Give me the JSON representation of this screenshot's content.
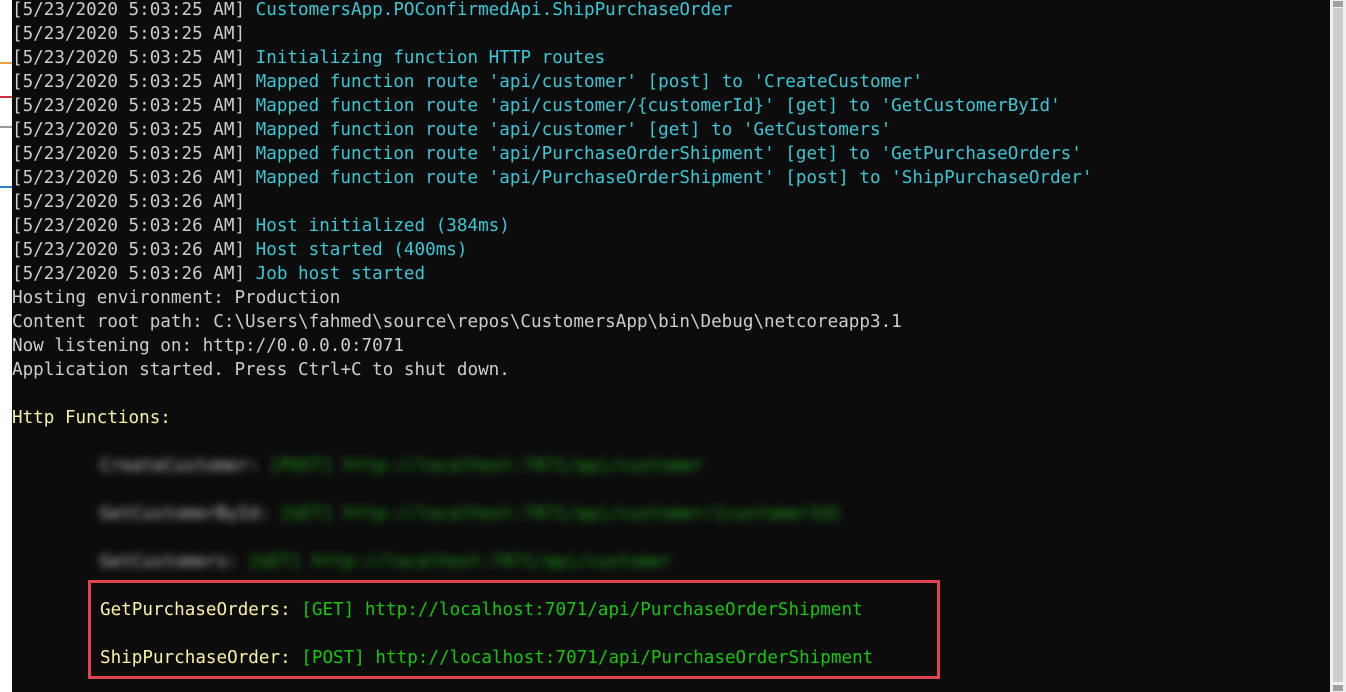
{
  "log_lines": [
    {
      "ts": "[5/23/2020 5:03:25 AM]",
      "msg": " CustomersApp.POConfirmedApi.ShipPurchaseOrder"
    },
    {
      "ts": "[5/23/2020 5:03:25 AM]",
      "msg": ""
    },
    {
      "ts": "[5/23/2020 5:03:25 AM]",
      "msg": " Initializing function HTTP routes"
    },
    {
      "ts": "[5/23/2020 5:03:25 AM]",
      "msg": " Mapped function route 'api/customer' [post] to 'CreateCustomer'"
    },
    {
      "ts": "[5/23/2020 5:03:25 AM]",
      "msg": " Mapped function route 'api/customer/{customerId}' [get] to 'GetCustomerById'"
    },
    {
      "ts": "[5/23/2020 5:03:25 AM]",
      "msg": " Mapped function route 'api/customer' [get] to 'GetCustomers'"
    },
    {
      "ts": "[5/23/2020 5:03:25 AM]",
      "msg": " Mapped function route 'api/PurchaseOrderShipment' [get] to 'GetPurchaseOrders'"
    },
    {
      "ts": "[5/23/2020 5:03:26 AM]",
      "msg": " Mapped function route 'api/PurchaseOrderShipment' [post] to 'ShipPurchaseOrder'"
    },
    {
      "ts": "[5/23/2020 5:03:26 AM]",
      "msg": ""
    },
    {
      "ts": "[5/23/2020 5:03:26 AM]",
      "msg": " Host initialized (384ms)"
    },
    {
      "ts": "[5/23/2020 5:03:26 AM]",
      "msg": " Host started (400ms)"
    },
    {
      "ts": "[5/23/2020 5:03:26 AM]",
      "msg": " Job host started"
    }
  ],
  "plain_lines": [
    "Hosting environment: Production",
    "Content root path: C:\\Users\\fahmed\\source\\repos\\CustomersApp\\bin\\Debug\\netcoreapp3.1",
    "Now listening on: http://0.0.0.0:7071",
    "Application started. Press Ctrl+C to shut down."
  ],
  "http_functions_header": "Http Functions:",
  "blurred_functions": [
    {
      "name": "CreateCustomer:",
      "rest": " [POST] http://localhost:7071/api/customer"
    },
    {
      "name": "GetCustomerById:",
      "rest": " [GET] http://localhost:7071/api/customer/{customerId}"
    },
    {
      "name": "GetCustomers:",
      "rest": " [GET] http://localhost:7071/api/customer"
    }
  ],
  "highlighted_functions": [
    {
      "name": "GetPurchaseOrders:",
      "method": " [GET]",
      "url": " http://localhost:7071/api/PurchaseOrderShipment"
    },
    {
      "name": "ShipPurchaseOrder:",
      "method": " [POST]",
      "url": " http://localhost:7071/api/PurchaseOrderShipment"
    }
  ],
  "colors": {
    "background": "#0c0c0c",
    "timestamp": "#cccccc",
    "log_message": "#3ac7d6",
    "function_name": "#f9f1a5",
    "function_url": "#16c60c",
    "highlight_border": "#e0444e"
  }
}
